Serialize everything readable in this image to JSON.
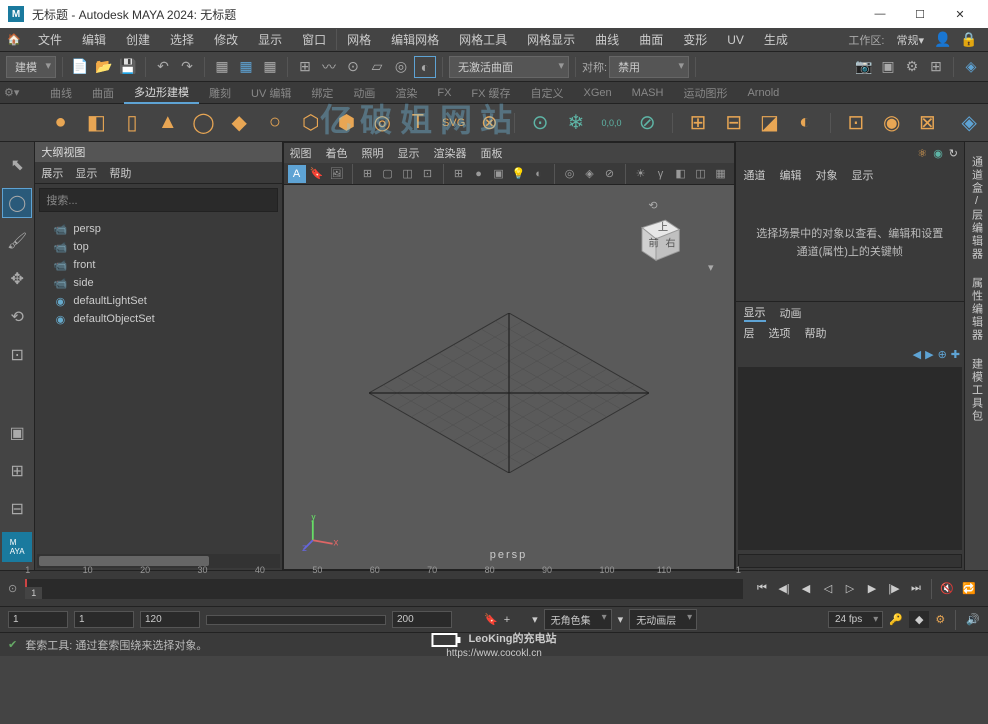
{
  "titlebar": {
    "icon": "M",
    "text": "无标题 - Autodesk MAYA 2024: 无标题"
  },
  "menubar": {
    "items": [
      "文件",
      "编辑",
      "创建",
      "选择",
      "修改",
      "显示",
      "窗口",
      "网格",
      "编辑网格",
      "网格工具",
      "网格显示",
      "曲线",
      "曲面",
      "变形",
      "UV",
      "生成"
    ],
    "workspace_label": "工作区:",
    "workspace_value": "常规"
  },
  "toolbar": {
    "mode": "建模",
    "activate_label": "无激活曲面",
    "sym_label": "对称:",
    "sym_value": "禁用"
  },
  "shelf": {
    "tabs": [
      "曲线",
      "曲面",
      "多边形建模",
      "雕刻",
      "UV 编辑",
      "绑定",
      "动画",
      "渲染",
      "FX",
      "FX 缓存",
      "自定义",
      "XGen",
      "MASH",
      "运动图形",
      "Arnold"
    ],
    "active_tab": 2,
    "origin_label": "0,0,0"
  },
  "outliner": {
    "title": "大纲视图",
    "menu": [
      "展示",
      "显示",
      "帮助"
    ],
    "search_placeholder": "搜索...",
    "items": [
      {
        "icon": "cam",
        "label": "persp"
      },
      {
        "icon": "cam",
        "label": "top"
      },
      {
        "icon": "cam",
        "label": "front"
      },
      {
        "icon": "cam",
        "label": "side"
      },
      {
        "icon": "set",
        "label": "defaultLightSet"
      },
      {
        "icon": "set",
        "label": "defaultObjectSet"
      }
    ]
  },
  "viewport": {
    "menu": [
      "视图",
      "着色",
      "照明",
      "显示",
      "渲染器",
      "面板"
    ],
    "camera_label": "persp",
    "cube_front": "前",
    "cube_right": "右",
    "cube_top": "上"
  },
  "channel_box": {
    "menu": [
      "通道",
      "编辑",
      "对象",
      "显示"
    ],
    "hint": "选择场景中的对象以查看、编辑和设置通道(属性)上的关键帧",
    "tabs": [
      "显示",
      "动画"
    ],
    "submenu": [
      "层",
      "选项",
      "帮助"
    ]
  },
  "right_tabs": [
    "通道盒/层编辑器",
    "属性编辑器",
    "建模工具包"
  ],
  "timeline": {
    "start": 1,
    "end": 200,
    "ticks": [
      1,
      10,
      20,
      30,
      40,
      50,
      60,
      70,
      80,
      90,
      100,
      110
    ],
    "current": 1
  },
  "range": {
    "start": 1,
    "end": 200,
    "vis_start": 1,
    "vis_end": 120,
    "char_set": "无角色集",
    "anim_layer": "无动画层",
    "fps": "24 fps"
  },
  "status": {
    "text": "套索工具: 通过套索围绕来选择对象。"
  },
  "watermark": {
    "title": "LeoKing的充电站",
    "url": "https://www.cocokl.cn"
  },
  "logo_watermark": "亿破姐网站"
}
